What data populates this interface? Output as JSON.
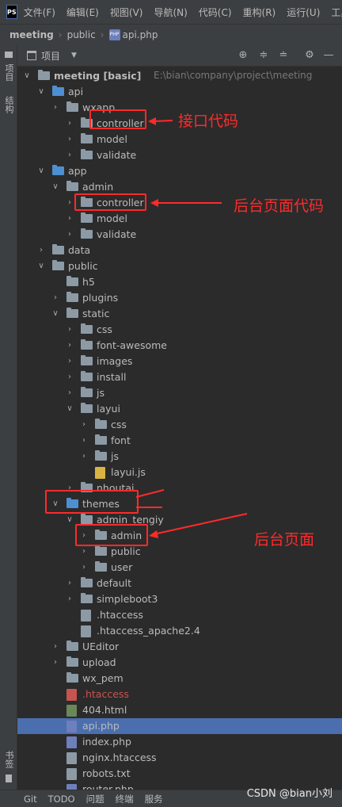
{
  "app": {
    "logo": "PS"
  },
  "menu": [
    "文件(F)",
    "编辑(E)",
    "视图(V)",
    "导航(N)",
    "代码(C)",
    "重构(R)",
    "运行(U)",
    "工具"
  ],
  "breadcrumb": {
    "project": "meeting",
    "folder": "public",
    "file": "api.php"
  },
  "left_tabs": {
    "project": "项目",
    "structure": "结构",
    "bookmarks": "书签"
  },
  "toolbar": {
    "title": "项目"
  },
  "tree": [
    {
      "label": "meeting [basic]",
      "path": "E:\\bian\\company\\project\\meeting"
    },
    {
      "label": "api"
    },
    {
      "label": "wxapp"
    },
    {
      "label": "controller"
    },
    {
      "label": "model"
    },
    {
      "label": "validate"
    },
    {
      "label": "app"
    },
    {
      "label": "admin"
    },
    {
      "label": "controller"
    },
    {
      "label": "model"
    },
    {
      "label": "validate"
    },
    {
      "label": "data"
    },
    {
      "label": "public"
    },
    {
      "label": "h5"
    },
    {
      "label": "plugins"
    },
    {
      "label": "static"
    },
    {
      "label": "css"
    },
    {
      "label": "font-awesome"
    },
    {
      "label": "images"
    },
    {
      "label": "install"
    },
    {
      "label": "js"
    },
    {
      "label": "layui"
    },
    {
      "label": "css"
    },
    {
      "label": "font"
    },
    {
      "label": "js"
    },
    {
      "label": "layui.js"
    },
    {
      "label": "nhoutai"
    },
    {
      "label": "themes"
    },
    {
      "label": "admin_tengiy"
    },
    {
      "label": "admin"
    },
    {
      "label": "public"
    },
    {
      "label": "user"
    },
    {
      "label": "default"
    },
    {
      "label": "simpleboot3"
    },
    {
      "label": ".htaccess"
    },
    {
      "label": ".htaccess_apache2.4"
    },
    {
      "label": "UEditor"
    },
    {
      "label": "upload"
    },
    {
      "label": "wx_pem"
    },
    {
      "label": ".htaccess"
    },
    {
      "label": "404.html"
    },
    {
      "label": "api.php"
    },
    {
      "label": "index.php"
    },
    {
      "label": "nginx.htaccess"
    },
    {
      "label": "robots.txt"
    },
    {
      "label": "router.php"
    }
  ],
  "annotations": {
    "api_controller": "接口代码",
    "admin_controller": "后台页面代码",
    "themes_admin": "后台页面",
    "annotation_color": "#ff2a2a"
  },
  "statusbar": [
    "Git",
    "TODO",
    "问题",
    "终端",
    "服务"
  ],
  "watermark": "CSDN @bian小刘",
  "colors": {
    "selected_row": "#4b6eaf",
    "folder": "#8c9aa6",
    "source_folder": "#4e8fd1"
  }
}
